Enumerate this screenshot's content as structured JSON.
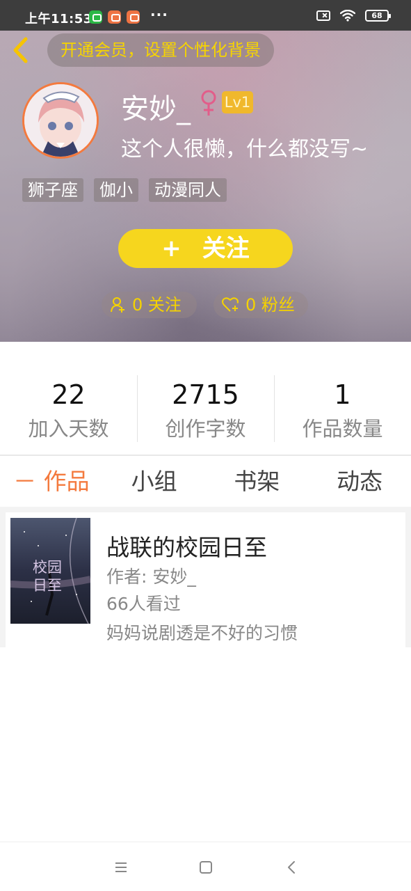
{
  "status_bar": {
    "time": "上午11:53",
    "battery": "68"
  },
  "header": {
    "vip_banner": "开通会员，设置个性化背景",
    "username": "安妙_",
    "gender": "♀",
    "level": "Lv1",
    "bio": "这个人很懒，什么都没写~",
    "tags": [
      "狮子座",
      "伽小",
      "动漫同人"
    ],
    "follow_button": {
      "plus": "+",
      "label": "关注"
    },
    "following": "0 关注",
    "fans": "0 粉丝"
  },
  "stats": [
    {
      "value": "22",
      "label": "加入天数"
    },
    {
      "value": "2715",
      "label": "创作字数"
    },
    {
      "value": "1",
      "label": "作品数量"
    }
  ],
  "tabs": [
    {
      "label": "－ 作品 －",
      "active": true
    },
    {
      "label": "小组",
      "active": false
    },
    {
      "label": "书架",
      "active": false
    },
    {
      "label": "动态",
      "active": false
    }
  ],
  "works": [
    {
      "title": "战联的校园日至",
      "author": "作者: 安妙_",
      "views": "66人看过",
      "description": "妈妈说剧透是不好的习惯",
      "cover_text": "校园日至"
    }
  ],
  "colors": {
    "accent": "#f47a3e",
    "follow_yellow": "#f6d61e",
    "vip_yellow": "#f6d400",
    "level_gold": "#f0b82c"
  }
}
